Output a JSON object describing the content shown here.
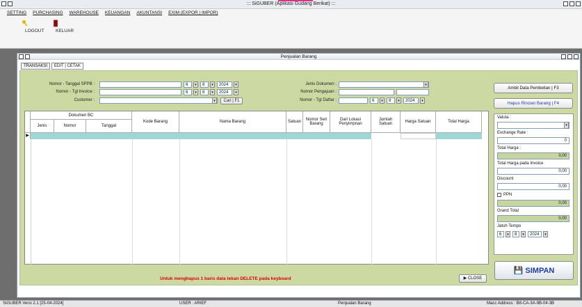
{
  "app": {
    "title": "::: SiGUBER (Aplikasi Gudang Berikat) :::",
    "menu": [
      "SETTING",
      "PURCHASING",
      "WAREHOUSE",
      "KEUANGAN",
      "AKUNTANSI",
      "EXIM (EXPOR | IMPOR)"
    ],
    "toolbar": {
      "logout": "LOGOUT",
      "keluar": "KELUAR"
    }
  },
  "window": {
    "title": "Penjualan Barang",
    "tabs": [
      "TRANSAKSI",
      "EDIT | CETAK"
    ]
  },
  "form": {
    "sppb_label": "Nomor - Tanggal SPPB :",
    "invoice_label": "Nomor - Tgl Invoice :",
    "customer_label": "Customer :",
    "jenis_dok_label": "Jenis Dokumen :",
    "nomor_pengajuan_label": "Nomor Pengajuan :",
    "nomor_tgl_daftar_label": "Nomor - Tgl Daftar :",
    "date_day": "6",
    "date_month": "8",
    "date_year": "2024",
    "cari_label": "Cari | F1"
  },
  "grid": {
    "headers": {
      "dokumen_bc": "Dokumen BC",
      "jenis": "Jenis",
      "nomor": "Nomor",
      "tanggal": "Tanggal",
      "kode_barang": "Kode Barang",
      "nama_barang": "Nama Barang",
      "satuan": "Satuan",
      "nomor_seri": "Nomor Seri Barang",
      "dari_lokasi": "Dari Lokasi Penyimpnan",
      "jumlah_satuan": "Jumlah Satuan",
      "harga_satuan": "Harga Satuan",
      "total_harga": "Total Harga"
    },
    "row_marker": "▶"
  },
  "message": "Untuk menghapus 1 baris data tekan DELETE pada keyboard",
  "close_label": "CLOSE",
  "right_panel": {
    "ambil_data": "Ambil Data Pembelian | F3",
    "hapus_rincian": "Hapus Rincian Barang | F4",
    "valuta_label": "Valuta :",
    "exchange_rate_label": "Exchange Rate :",
    "exchange_rate_value": "0",
    "total_harga_label": "Total Harga :",
    "total_harga_value": "0,00",
    "total_invoice_label": "Total Harga pada Invoice",
    "total_invoice_value": "0,00",
    "discount_label": "Discount",
    "discount_value": "0,00",
    "ppn_label": "PPN",
    "ppn_value": "0,00",
    "grand_total_label": "Grand Total",
    "grand_total_value": "0,00",
    "jatuh_tempo_label": "Jatuh Tempo",
    "simpan_label": "SIMPAN"
  },
  "status": {
    "version": "SiGUBER Versi 2.1 [25-04-2024]",
    "user": "USER : ARIEF",
    "form": "Penjualan Barang",
    "mac": "Macc Address : B8-CA-3A-9B-04-3B"
  }
}
